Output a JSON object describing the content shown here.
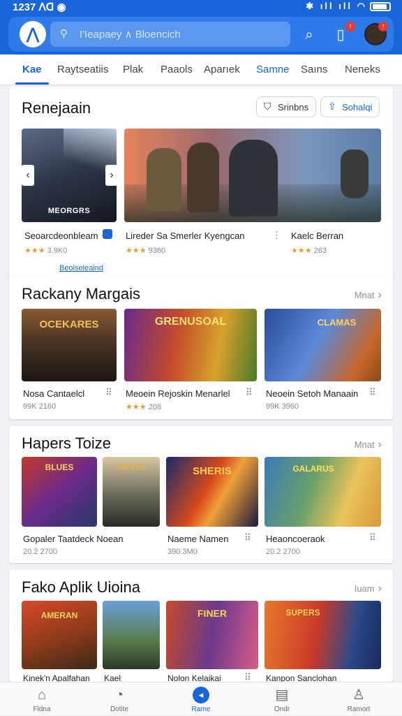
{
  "status_bar": {
    "time": "1237",
    "time_suffix": "ᐱᗡ",
    "icons": "✱ ıll ıll ◠"
  },
  "search": {
    "placeholder": "I'Ieapaey ∧ Bloencich",
    "logo_letter": "⋀"
  },
  "top_icons": {
    "badge1": "!",
    "badge2": "!"
  },
  "tabs": [
    {
      "label": "Kae"
    },
    {
      "label": "Raytseatiis"
    },
    {
      "label": "Plak"
    },
    {
      "label": "Paaols"
    },
    {
      "label": "Aparıek"
    },
    {
      "label": "Samne"
    },
    {
      "label": "Saıns"
    },
    {
      "label": "Neneks"
    }
  ],
  "section1": {
    "title": "Renejaain",
    "pill1": "Srinbns",
    "pill2": "Sohalqi",
    "overlay": "MEORGRS",
    "link": "Beoiseleaind",
    "cards": [
      {
        "title": "Seoarcdeonbleam",
        "meta": "3.9K0",
        "stars": "★★★"
      },
      {
        "title": "Lireder Sa Smerler Kyengcan",
        "meta": "9360",
        "stars": "★★★"
      },
      {
        "title": "Kaelc Berran",
        "meta": "263",
        "stars": "★★★"
      }
    ]
  },
  "section2": {
    "title": "Rackany Margais",
    "more": "Mnat",
    "cards": [
      {
        "title": "Nosa Cantaelcl",
        "meta": "99K 2160",
        "art": "OCEKARES"
      },
      {
        "title": "Meoein Rejoskin Menarlel",
        "meta": "208",
        "stars": "★★★",
        "art": "GRENUSOAL"
      },
      {
        "title": "Neoein Setoh Manaain",
        "meta": "99K 3960",
        "art": "CLAMAS"
      }
    ]
  },
  "section3": {
    "title": "Hapers Toize",
    "more": "Mnat",
    "cards": [
      {
        "title": "Gopaler Taatdeck Noean",
        "meta": "20.2 2700",
        "art1": "BLUES",
        "art2": "ORAYS"
      },
      {
        "title": "Naeme Namen",
        "meta": "390.3M0",
        "art": "SHERIS"
      },
      {
        "title": "Heaoncoeraok",
        "meta": "20.2 2700",
        "art": "GALARUS"
      }
    ]
  },
  "section4": {
    "title": "Fako Aplik Uioina",
    "more": "Iuam",
    "cards": [
      {
        "title": "Kinek'n Apalfahan",
        "art": "AMERAN"
      },
      {
        "title": "Kael",
        "art": ""
      },
      {
        "title": "Nolon Kelaikai",
        "art": "FINER"
      },
      {
        "title": "Kanpon Sanclohan",
        "art": "SUPERS"
      }
    ]
  },
  "bottom_nav": [
    {
      "label": "Fldna",
      "icon": "⌂"
    },
    {
      "label": "Dotite",
      "icon": "◔"
    },
    {
      "label": "Rarne",
      "icon": "◂"
    },
    {
      "label": "Ondr",
      "icon": "▤"
    },
    {
      "label": "Ramort",
      "icon": "♙"
    }
  ],
  "colors": {
    "brand": "#1a66d8",
    "accent_star": "#e0a030",
    "bg": "#eef0f4"
  }
}
